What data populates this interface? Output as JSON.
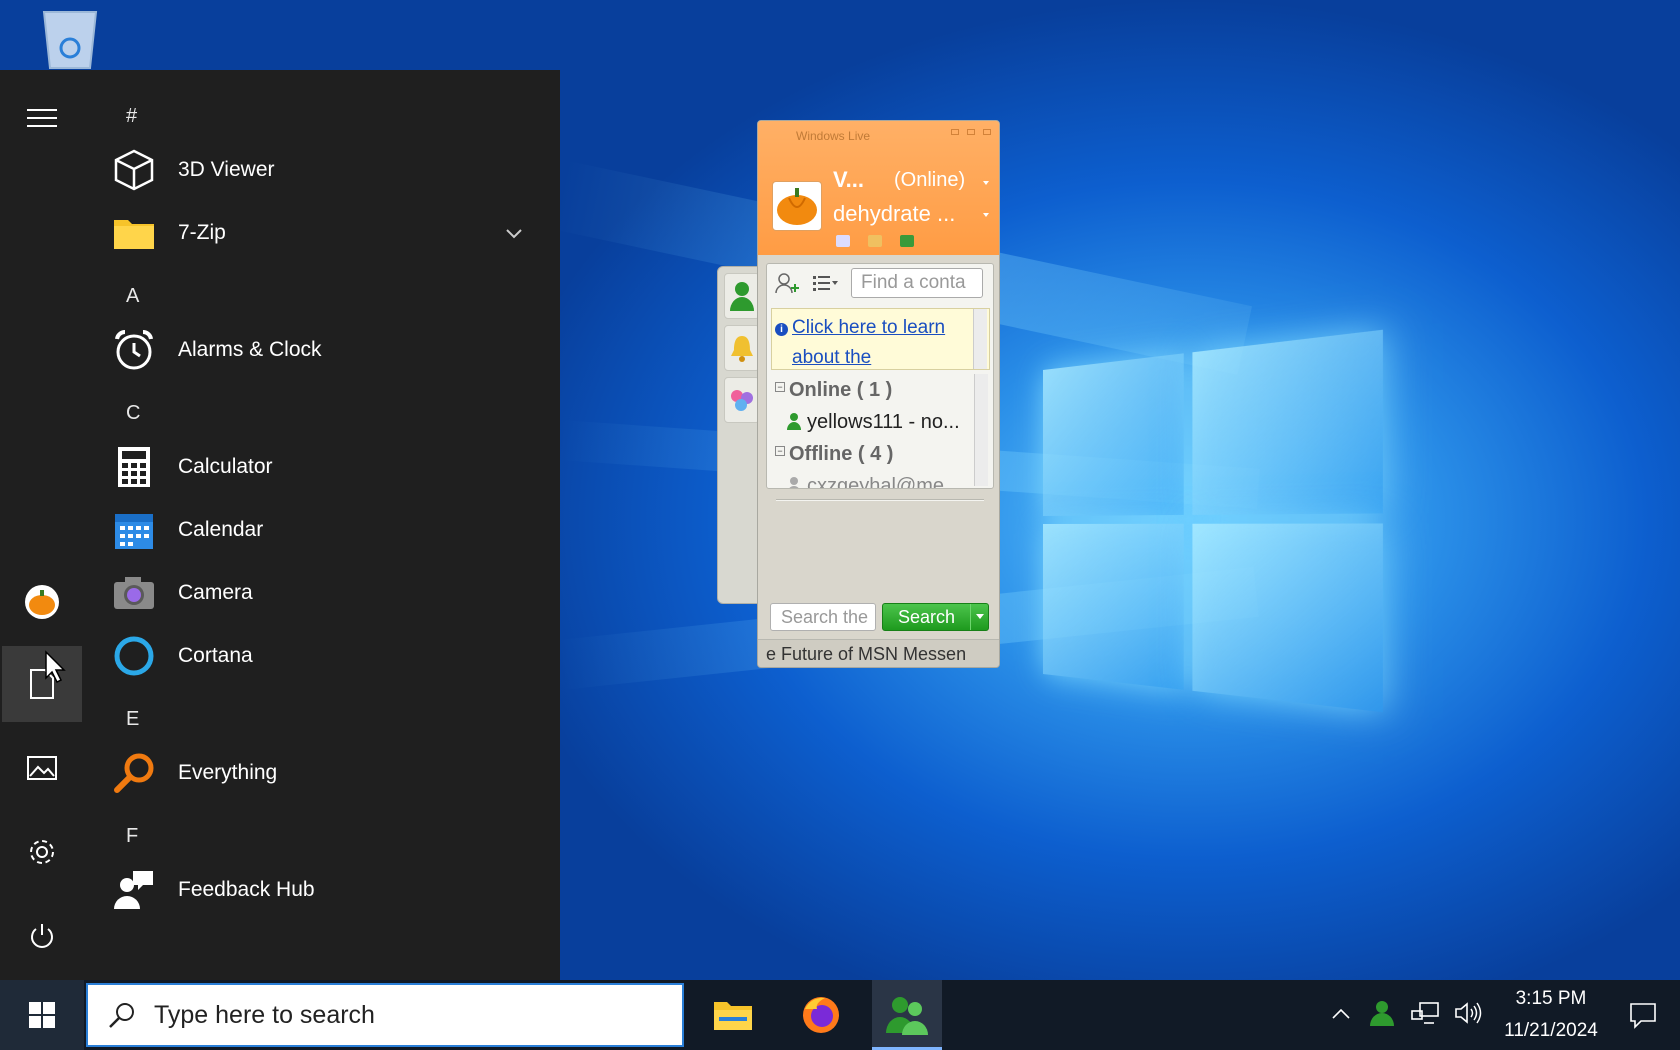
{
  "start_menu": {
    "sections": [
      {
        "letter": "#",
        "apps": [
          {
            "name": "3D Viewer",
            "icon": "cube-icon"
          },
          {
            "name": "7-Zip",
            "icon": "folder-icon",
            "expandable": true
          }
        ]
      },
      {
        "letter": "A",
        "apps": [
          {
            "name": "Alarms & Clock",
            "icon": "alarm-clock-icon"
          }
        ]
      },
      {
        "letter": "C",
        "apps": [
          {
            "name": "Calculator",
            "icon": "calculator-icon"
          },
          {
            "name": "Calendar",
            "icon": "calendar-icon"
          },
          {
            "name": "Camera",
            "icon": "camera-icon"
          },
          {
            "name": "Cortana",
            "icon": "cortana-ring-icon"
          }
        ]
      },
      {
        "letter": "E",
        "apps": [
          {
            "name": "Everything",
            "icon": "magnifier-orange-icon"
          }
        ]
      },
      {
        "letter": "F",
        "apps": [
          {
            "name": "Feedback Hub",
            "icon": "feedback-hub-icon"
          }
        ]
      }
    ]
  },
  "messenger": {
    "title": "Windows Live",
    "display_name": "V...",
    "status": "(Online)",
    "personal_message": "dehydrate ...",
    "find_placeholder": "Find a conta",
    "info_link": "Click here to learn about the",
    "groups": {
      "online": "Online ( 1 )",
      "offline": "Offline ( 4 )"
    },
    "contacts": {
      "online_first": "yellows111 - no...",
      "offline_first": "cxzgeyhal@me..."
    },
    "web_search_placeholder": "Search the",
    "search_label": "Search",
    "footer": "e Future of MSN Messen"
  },
  "taskbar": {
    "search_placeholder": "Type here to search",
    "time": "3:15 PM",
    "date": "11/21/2024"
  },
  "colors": {
    "msn_orange": "#ff9c44",
    "start_bg": "#1f1f1f",
    "taskbar_bg": "#111a26",
    "search_green": "#1e9a1e"
  }
}
